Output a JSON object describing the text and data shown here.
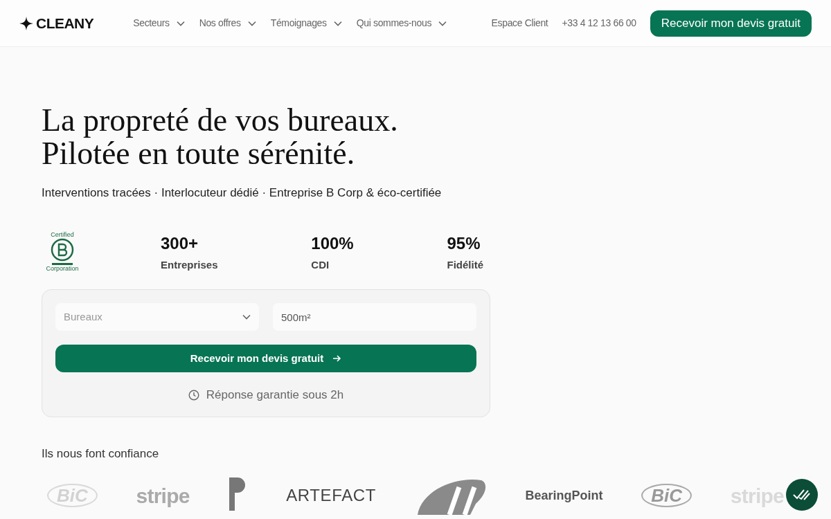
{
  "header": {
    "logo": "CLEANY",
    "nav": [
      {
        "label": "Secteurs"
      },
      {
        "label": "Nos offres"
      },
      {
        "label": "Témoignages"
      },
      {
        "label": "Qui sommes-nous"
      }
    ],
    "client_link": "Espace Client",
    "phone": "+33 4 12 13 66 00",
    "cta": "Recevoir mon devis gratuit"
  },
  "hero": {
    "title_lines": [
      "La propreté de vos bureaux.",
      "Pilotée en toute sérénité."
    ],
    "subtitle": "Interventions tracées · Interlocuteur dédié · Entreprise B Corp & éco-certifiée"
  },
  "badge": {
    "top": "Certified",
    "bottom": "Corporation"
  },
  "stats": [
    {
      "value": "300+",
      "label": "Entreprises"
    },
    {
      "value": "100%",
      "label": "CDI"
    },
    {
      "value": "95%",
      "label": "Fidélité"
    }
  ],
  "form": {
    "select_placeholder": "Bureaux",
    "area_value": "500m²",
    "submit": "Recevoir mon devis gratuit",
    "note": "Réponse garantie sous 2h"
  },
  "trust": {
    "title": "Ils nous font confiance",
    "logos": [
      {
        "kind": "bic",
        "text": "BiC",
        "faded": true
      },
      {
        "kind": "stripe",
        "text": "stripe",
        "faded": false
      },
      {
        "kind": "p"
      },
      {
        "kind": "word",
        "text": "ARTEFACT",
        "faded": false
      },
      {
        "kind": "sii"
      },
      {
        "kind": "bearing",
        "text": "BearingPoint",
        "faded": false
      },
      {
        "kind": "bic",
        "text": "BiC",
        "faded": false
      },
      {
        "kind": "stripe",
        "text": "stripe",
        "faded": true
      }
    ]
  }
}
